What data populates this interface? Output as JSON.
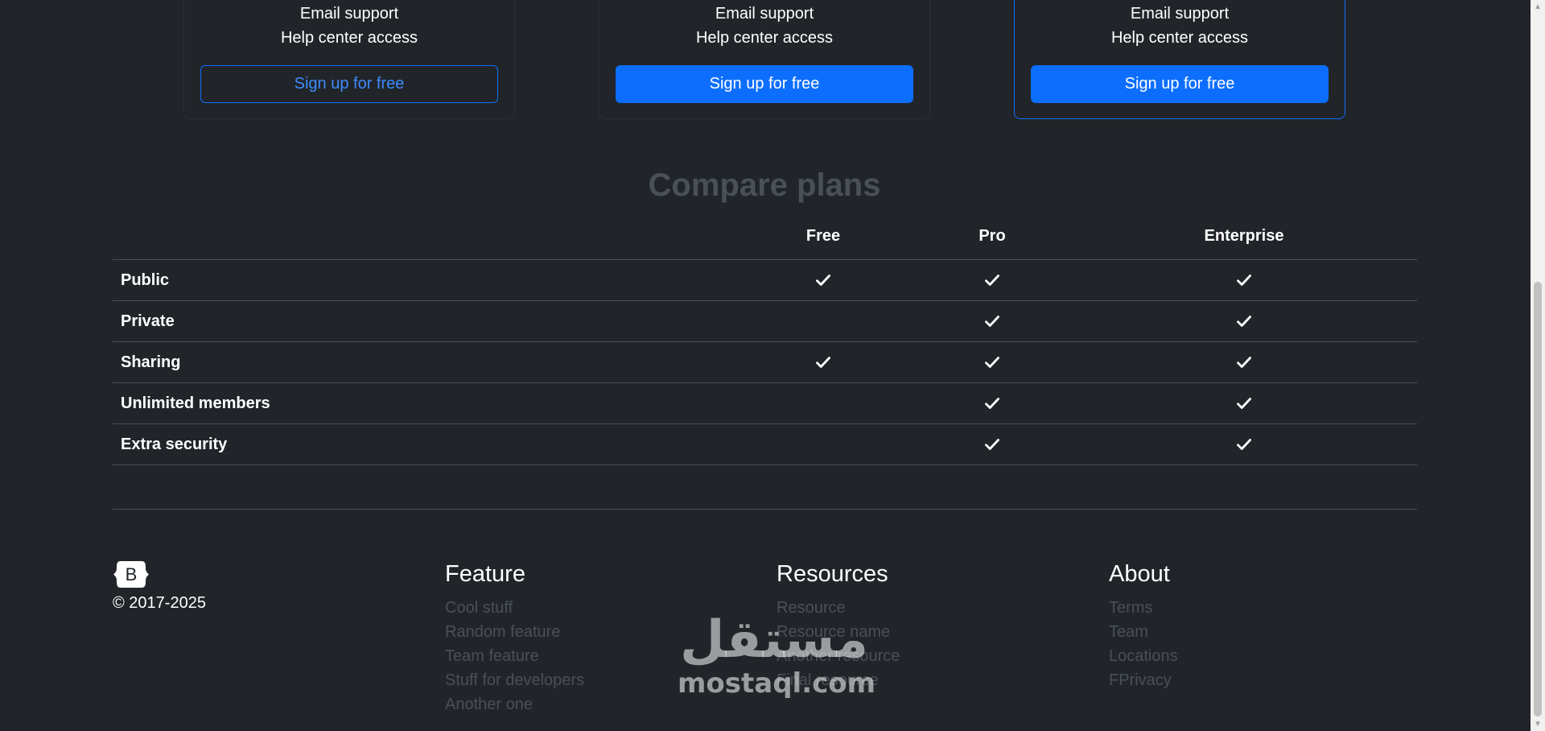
{
  "cards": [
    {
      "features": [
        "Email support",
        "Help center access"
      ],
      "button": "Sign up for free",
      "style": "outline"
    },
    {
      "features": [
        "Email support",
        "Help center access"
      ],
      "button": "Sign up for free",
      "style": "solid"
    },
    {
      "features": [
        "Email support",
        "Help center access"
      ],
      "button": "Sign up for free",
      "style": "solid",
      "highlight": true
    }
  ],
  "compare": {
    "title": "Compare plans",
    "columns": [
      "Free",
      "Pro",
      "Enterprise"
    ],
    "rows": [
      {
        "label": "Public",
        "checks": [
          true,
          true,
          true
        ]
      },
      {
        "label": "Private",
        "checks": [
          false,
          true,
          true
        ]
      },
      {
        "label": "Sharing",
        "checks": [
          true,
          true,
          true
        ]
      },
      {
        "label": "Unlimited members",
        "checks": [
          false,
          true,
          true
        ]
      },
      {
        "label": "Extra security",
        "checks": [
          false,
          true,
          true
        ]
      }
    ]
  },
  "footer": {
    "logo_letter": "B",
    "copyright": "© 2017-2025",
    "columns": [
      {
        "title": "Feature",
        "links": [
          "Cool stuff",
          "Random feature",
          "Team feature",
          "Stuff for developers",
          "Another one"
        ]
      },
      {
        "title": "Resources",
        "links": [
          "Resource",
          "Resource name",
          "Another resource",
          "Final resource"
        ]
      },
      {
        "title": "About",
        "links": [
          "Terms",
          "Team",
          "Locations",
          "FPrivacy"
        ]
      }
    ]
  },
  "watermark": {
    "arabic": "مستقل",
    "latin": "mostaql.com"
  },
  "colors": {
    "accent": "#0d6efd",
    "background": "#212529",
    "muted": "#495057"
  }
}
